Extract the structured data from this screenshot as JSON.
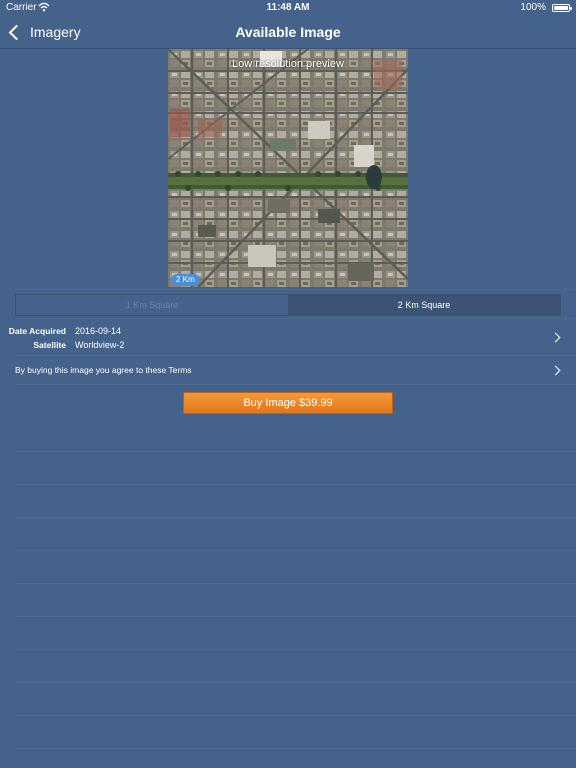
{
  "status_bar": {
    "carrier": "Carrier",
    "time": "11:48 AM",
    "battery_percent": "100%"
  },
  "nav": {
    "back_label": "Imagery",
    "title": "Available Image"
  },
  "preview": {
    "caption": "Low resolution preview",
    "scale_badge": "2 Km"
  },
  "segmented": {
    "options": [
      "1 Km Square",
      "2 Km Square"
    ],
    "selected": "2 Km Square"
  },
  "details": {
    "date_label": "Date Acquired",
    "date_value": "2016-09-14",
    "satellite_label": "Satellite",
    "satellite_value": "Worldview-2"
  },
  "terms": {
    "text": "By buying this image you agree to these Terms"
  },
  "buy_button": {
    "label": "Buy Image $39.99"
  },
  "colors": {
    "background": "#45628a",
    "segment_active": "#3b5476",
    "buy_button": "#e8821f",
    "scale_badge": "#4a8fd6"
  },
  "icons": [
    "wifi-icon",
    "battery-icon",
    "back-chevron-icon",
    "chevron-right-icon"
  ]
}
